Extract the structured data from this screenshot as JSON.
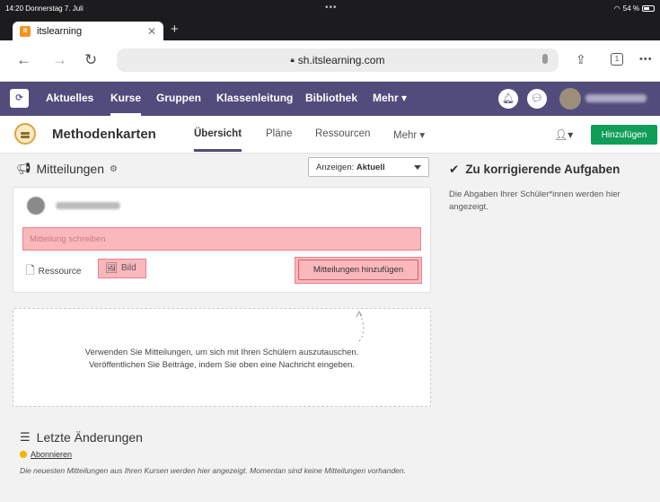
{
  "status_bar": {
    "time": "14:20  Donnerstag 7. Juli",
    "battery": "54 %"
  },
  "browser": {
    "tab_title": "itslearning",
    "url": "sh.itslearning.com",
    "tab_count": "1"
  },
  "topnav": {
    "logo": "⟳",
    "items": [
      "Aktuelles",
      "Kurse",
      "Gruppen",
      "Klassenleitung",
      "Bibliothek",
      "Mehr ▾"
    ]
  },
  "course": {
    "title": "Methodenkarten",
    "tabs": [
      "Übersicht",
      "Pläne",
      "Ressourcen",
      "Mehr ▾"
    ],
    "add_button": "Hinzufügen"
  },
  "announcements": {
    "title": "Mitteilungen",
    "filter_prefix": "Anzeigen: ",
    "filter_value": "Aktuell",
    "input_placeholder": "Mitteilung schreiben",
    "resource_label": "Ressource",
    "image_label": "Bild",
    "submit_label": "Mitteilungen hinzufügen",
    "empty_line1": "Verwenden Sie Mitteilungen, um sich mit Ihren Schülern auszutauschen.",
    "empty_line2": "Veröffentlichen Sie Beiträge, indem Sie oben eine Nachricht eingeben."
  },
  "tasks": {
    "title": "Zu korrigierende Aufgaben",
    "text": "Die Abgaben Ihrer Schüler*innen werden hier angezeigt."
  },
  "changes": {
    "title": "Letzte Änderungen",
    "subscribe": "Abonnieren",
    "text": "Die neuesten Mitteilungen aus Ihren Kursen werden hier angezeigt. Momentan sind keine Mitteilungen vorhanden."
  },
  "colors": {
    "nav_bg": "#524c7c",
    "add_button": "#0f9d58",
    "highlight": "#f899a0"
  }
}
